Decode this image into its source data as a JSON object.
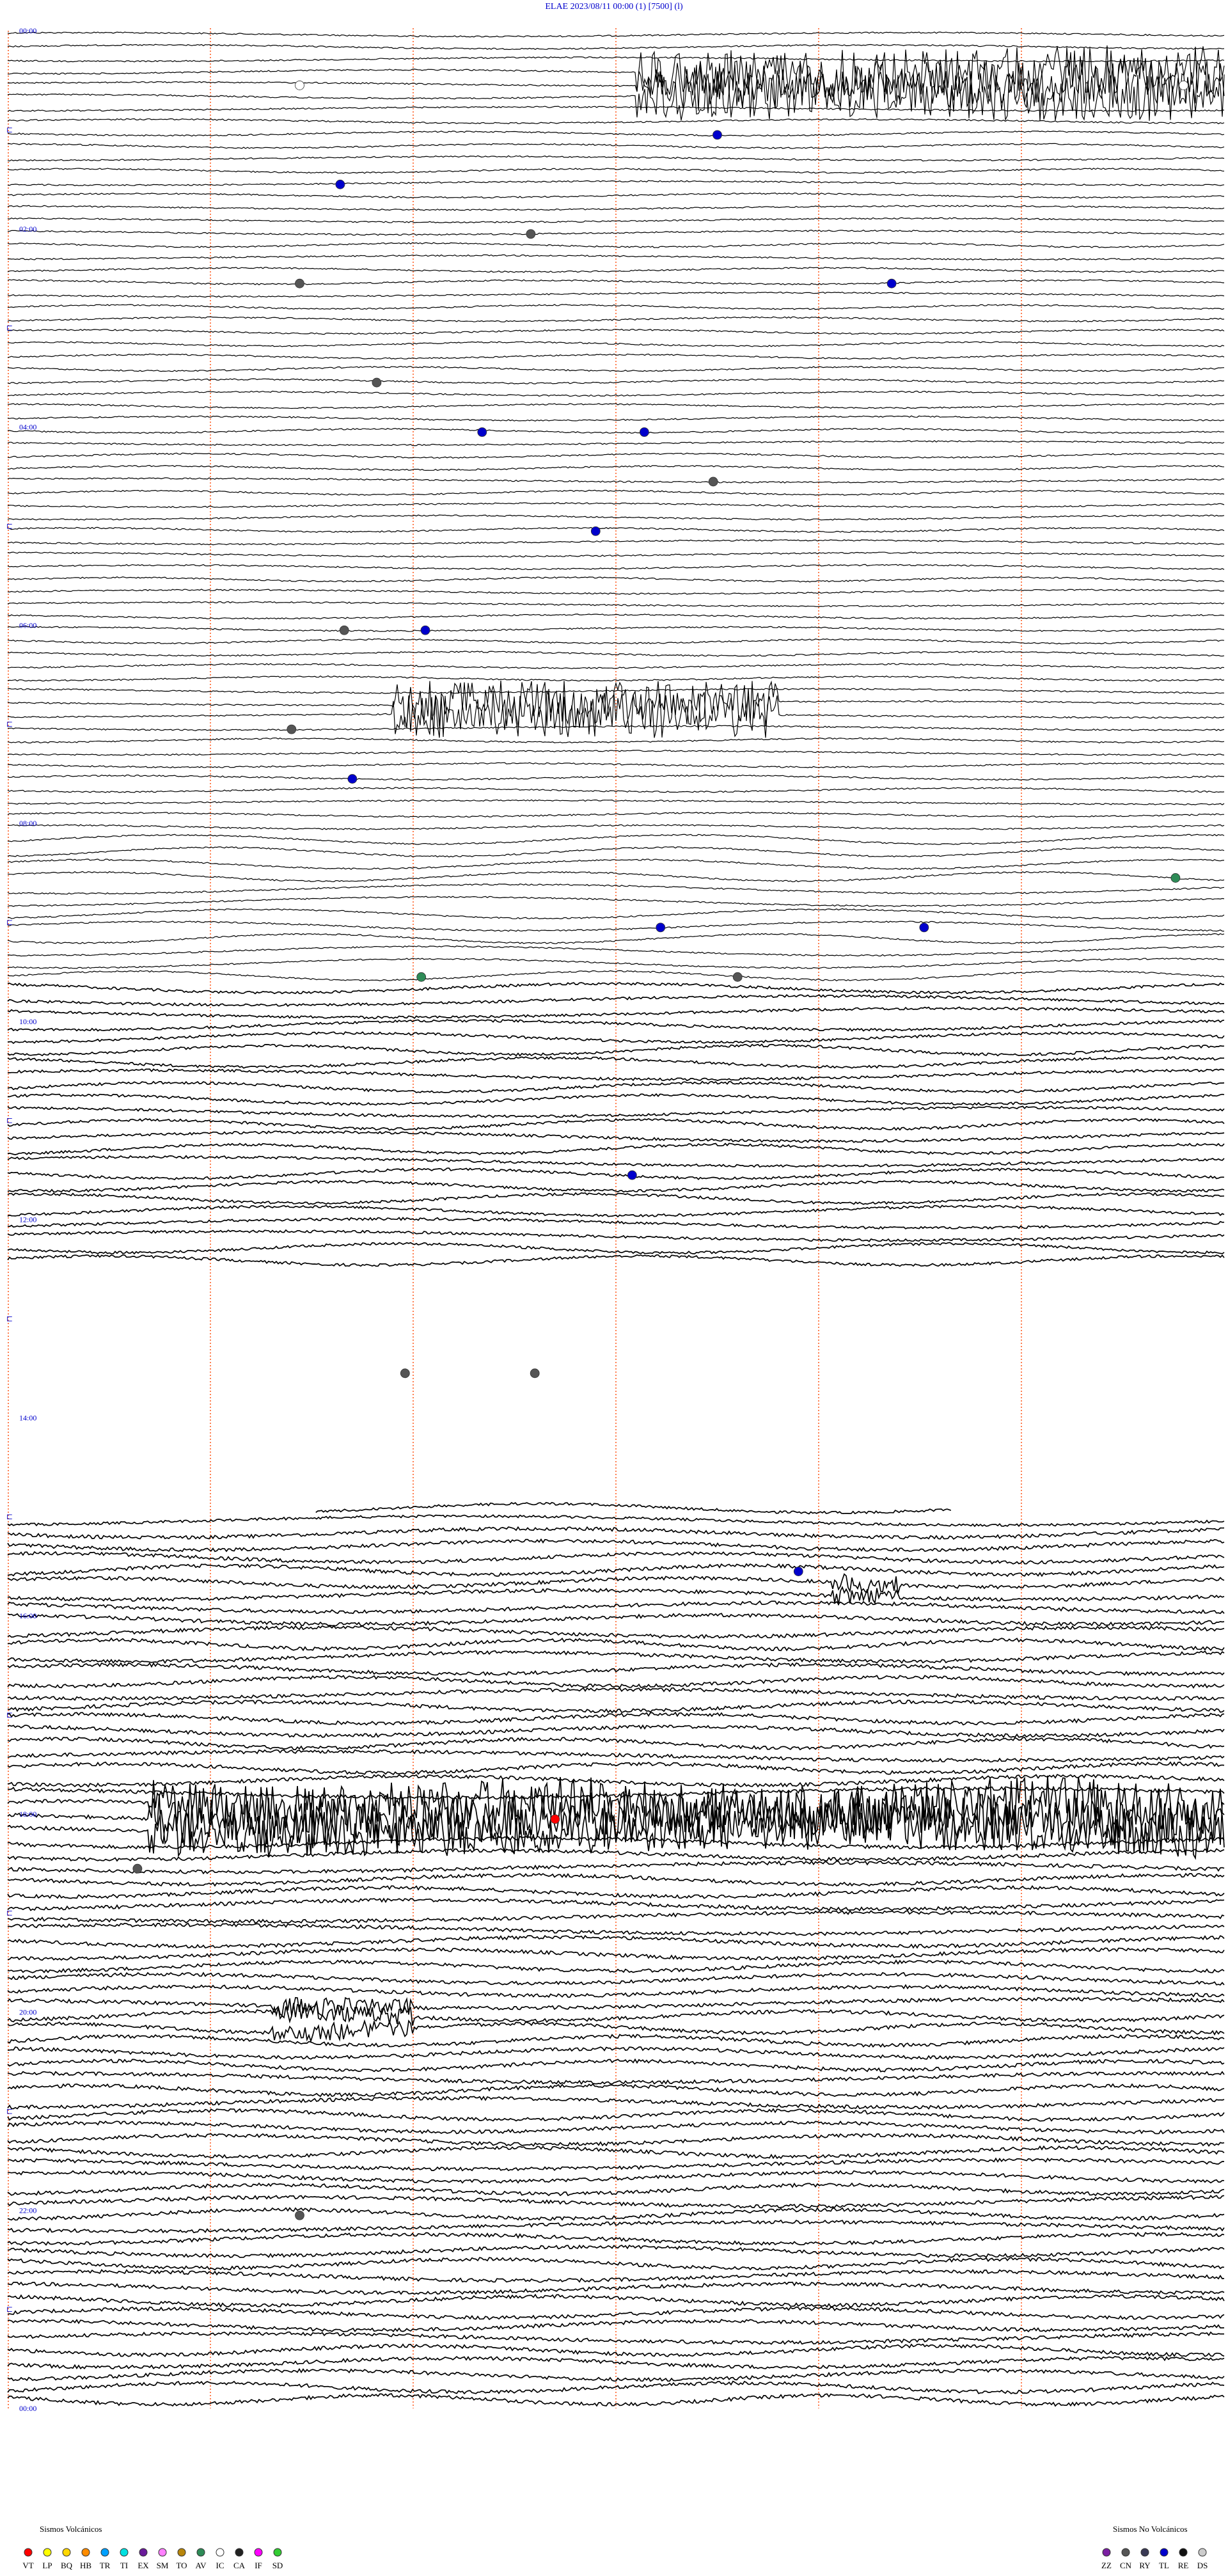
{
  "header": {
    "station": "ELAE",
    "datetime": "2023/08/11 00:00",
    "flag1": "(1)",
    "gain": "[7500]",
    "flag2": "(l)"
  },
  "chart_data": {
    "type": "line",
    "title": "ELAE   2023/08/11 00:00   (1)   [7500]  (l)",
    "xlabel": "",
    "ylabel": "",
    "trace_duration_minutes": 30,
    "minute_markers": [
      5,
      10,
      15,
      20,
      25
    ],
    "time_labels": [
      "00:00",
      "02:00",
      "04:00",
      "06:00",
      "08:00",
      "10:00",
      "12:00",
      "14:00",
      "16:00",
      "18:00",
      "20:00",
      "22:00",
      "00:00"
    ],
    "hours": 24,
    "gap": {
      "start": "12:30",
      "end": "14:50"
    },
    "bursts": [
      {
        "start_hour": 0.5,
        "x_start_min": 15.5,
        "x_end_min": 30,
        "label": "tremor"
      },
      {
        "start_hour": 6.8,
        "x_start_min": 9.5,
        "x_end_min": 19,
        "label": "tremor"
      },
      {
        "start_hour": 18.0,
        "x_start_min": 3.5,
        "x_end_min": 30,
        "label": "tremor"
      },
      {
        "start_hour": 20.0,
        "x_start_min": 6.5,
        "x_end_min": 10,
        "label": "small"
      },
      {
        "start_hour": 15.7,
        "x_start_min": 20.3,
        "x_end_min": 22,
        "label": "small"
      }
    ],
    "events": [
      {
        "hour": 0.5,
        "minute": 7.2,
        "type": "IC"
      },
      {
        "hour": 0.5,
        "minute": 29.0,
        "type": "IC"
      },
      {
        "hour": 1.0,
        "minute": 17.5,
        "type": "TL"
      },
      {
        "hour": 1.5,
        "minute": 8.2,
        "type": "TL"
      },
      {
        "hour": 2.0,
        "minute": 12.9,
        "type": "CN"
      },
      {
        "hour": 2.5,
        "minute": 7.2,
        "type": "CN"
      },
      {
        "hour": 2.5,
        "minute": 21.8,
        "type": "TL"
      },
      {
        "hour": 3.5,
        "minute": 9.1,
        "type": "CN"
      },
      {
        "hour": 4.0,
        "minute": 11.7,
        "type": "TL"
      },
      {
        "hour": 4.0,
        "minute": 15.7,
        "type": "TL"
      },
      {
        "hour": 4.5,
        "minute": 17.4,
        "type": "CN"
      },
      {
        "hour": 5.0,
        "minute": 14.5,
        "type": "TL"
      },
      {
        "hour": 6.0,
        "minute": 8.3,
        "type": "CN"
      },
      {
        "hour": 6.0,
        "minute": 10.3,
        "type": "TL"
      },
      {
        "hour": 7.0,
        "minute": 7.0,
        "type": "CN"
      },
      {
        "hour": 7.5,
        "minute": 8.5,
        "type": "TL"
      },
      {
        "hour": 9.0,
        "minute": 16.1,
        "type": "TL"
      },
      {
        "hour": 9.0,
        "minute": 22.6,
        "type": "TL"
      },
      {
        "hour": 9.5,
        "minute": 18.0,
        "type": "CN"
      },
      {
        "hour": 9.5,
        "minute": 10.2,
        "type": "AV"
      },
      {
        "hour": 8.5,
        "minute": 28.8,
        "type": "AV"
      },
      {
        "hour": 11.5,
        "minute": 15.4,
        "type": "TL"
      },
      {
        "hour": 13.5,
        "minute": 9.8,
        "type": "CN"
      },
      {
        "hour": 13.5,
        "minute": 13.0,
        "type": "CN"
      },
      {
        "hour": 15.5,
        "minute": 19.5,
        "type": "TL"
      },
      {
        "hour": 18.0,
        "minute": 13.5,
        "type": "VT"
      },
      {
        "hour": 18.5,
        "minute": 3.2,
        "type": "CN"
      },
      {
        "hour": 22.0,
        "minute": 7.2,
        "type": "CN"
      }
    ]
  },
  "legend": {
    "volcanic": {
      "title": "Sismos Volcánicos",
      "items": [
        {
          "code": "VT",
          "color": "#ff0000"
        },
        {
          "code": "LP",
          "color": "#ffff00"
        },
        {
          "code": "BQ",
          "color": "#ffd700"
        },
        {
          "code": "HB",
          "color": "#ff8c00"
        },
        {
          "code": "TR",
          "color": "#00a0ff"
        },
        {
          "code": "TI",
          "color": "#00e0e0"
        },
        {
          "code": "EX",
          "color": "#6a1b9a"
        },
        {
          "code": "SM",
          "color": "#ff80ff"
        },
        {
          "code": "TO",
          "color": "#b8860b"
        },
        {
          "code": "AV",
          "color": "#2e8b57"
        },
        {
          "code": "IC",
          "color": "#ffffff"
        },
        {
          "code": "CA",
          "color": "#222222"
        },
        {
          "code": "IF",
          "color": "#ff00ff"
        },
        {
          "code": "SD",
          "color": "#33cc33"
        }
      ]
    },
    "nonvolcanic": {
      "title": "Sismos No Volcánicos",
      "items": [
        {
          "code": "ZZ",
          "color": "#7b1fa2"
        },
        {
          "code": "CN",
          "color": "#555555"
        },
        {
          "code": "RY",
          "color": "#3a3a55"
        },
        {
          "code": "TL",
          "color": "#0000cc"
        },
        {
          "code": "RE",
          "color": "#111111"
        },
        {
          "code": "DS",
          "color": "#cccccc"
        }
      ]
    }
  },
  "colors": {
    "trace": "#000000",
    "marker": "#ff7f50",
    "labels": "#0000cc",
    "background": "#ffffff"
  }
}
